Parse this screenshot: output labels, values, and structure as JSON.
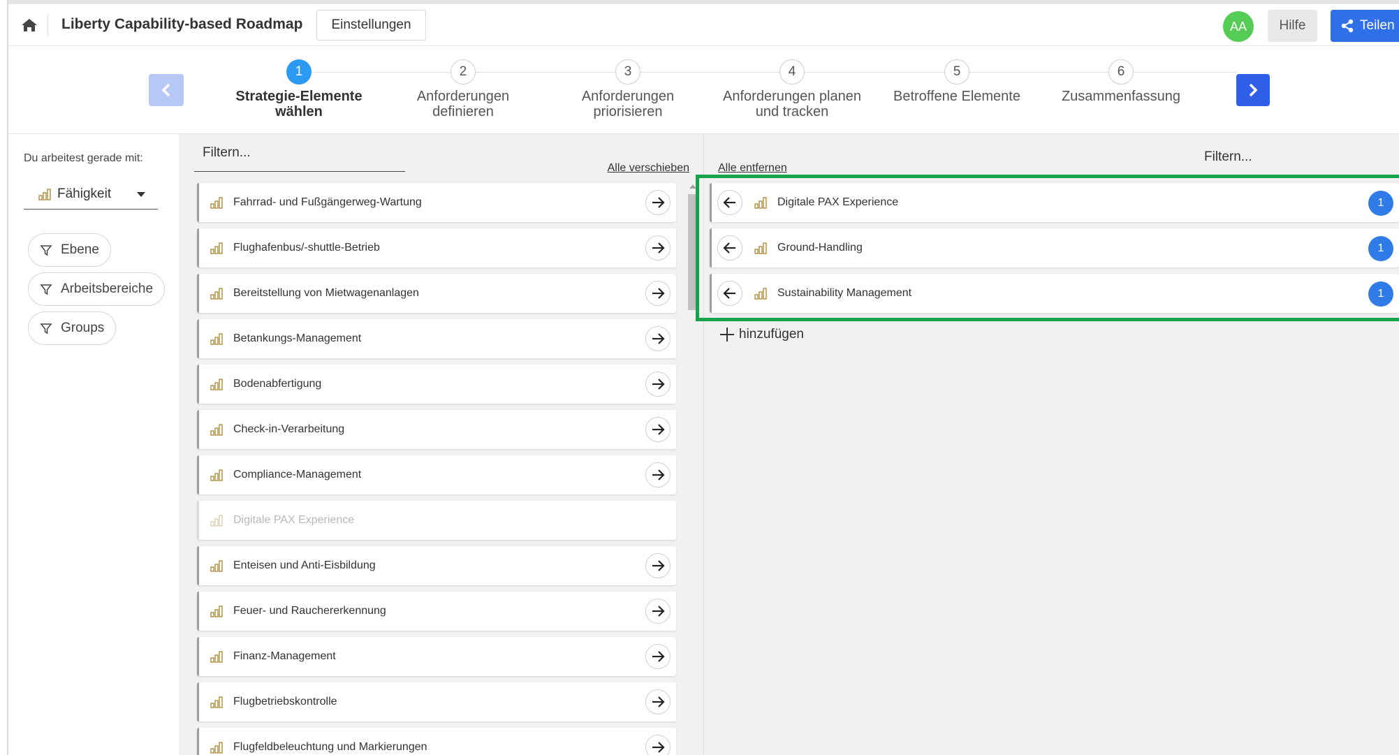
{
  "header": {
    "title": "Liberty Capability-based Roadmap",
    "settings_label": "Einstellungen",
    "avatar_initials": "AA",
    "help_label": "Hilfe",
    "share_label": "Teilen"
  },
  "stepper": {
    "steps": [
      {
        "number": "1",
        "label_line1": "Strategie-Elemente",
        "label_line2": "wählen",
        "active": true
      },
      {
        "number": "2",
        "label_line1": "Anforderungen",
        "label_line2": "definieren",
        "active": false
      },
      {
        "number": "3",
        "label_line1": "Anforderungen",
        "label_line2": "priorisieren",
        "active": false
      },
      {
        "number": "4",
        "label_line1": "Anforderungen planen",
        "label_line2": "und tracken",
        "active": false
      },
      {
        "number": "5",
        "label_line1": "Betroffene Elemente",
        "label_line2": "",
        "active": false
      },
      {
        "number": "6",
        "label_line1": "Zusammenfassung",
        "label_line2": "",
        "active": false
      }
    ]
  },
  "sidebar": {
    "working_label": "Du arbeitest gerade mit:",
    "type_value": "Fähigkeit",
    "filters": [
      "Ebene",
      "Arbeitsbereiche",
      "Groups"
    ]
  },
  "available": {
    "filter_placeholder": "Filtern...",
    "move_all_label": "Alle verschieben",
    "items": [
      {
        "label": "Fahrrad- und Fußgängerweg-Wartung",
        "disabled": false
      },
      {
        "label": "Flughafenbus/-shuttle-Betrieb",
        "disabled": false
      },
      {
        "label": "Bereitstellung von Mietwagenanlagen",
        "disabled": false
      },
      {
        "label": "Betankungs-Management",
        "disabled": false
      },
      {
        "label": "Bodenabfertigung",
        "disabled": false
      },
      {
        "label": "Check-in-Verarbeitung",
        "disabled": false
      },
      {
        "label": "Compliance-Management",
        "disabled": false
      },
      {
        "label": "Digitale PAX Experience",
        "disabled": true
      },
      {
        "label": "Enteisen und Anti-Eisbildung",
        "disabled": false
      },
      {
        "label": "Feuer- und Rauchererkennung",
        "disabled": false
      },
      {
        "label": "Finanz-Management",
        "disabled": false
      },
      {
        "label": "Flugbetriebskontrolle",
        "disabled": false
      },
      {
        "label": "Flugfeldbeleuchtung und Markierungen",
        "disabled": false
      }
    ]
  },
  "selected": {
    "remove_all_label": "Alle entfernen",
    "filter_placeholder": "Filtern...",
    "add_label": "hinzufügen",
    "items": [
      {
        "label": "Digitale PAX Experience",
        "count": "1"
      },
      {
        "label": "Ground-Handling",
        "count": "1"
      },
      {
        "label": "Sustainability Management",
        "count": "1"
      }
    ]
  },
  "colors": {
    "primary": "#2f6fe8",
    "step_active": "#2b9af3",
    "avatar": "#55cc55",
    "highlight": "#16a34a"
  }
}
